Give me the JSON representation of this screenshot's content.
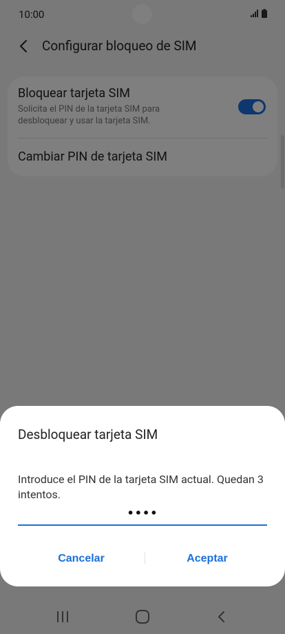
{
  "status_bar": {
    "time": "10:00",
    "icons": [
      "signal-icon",
      "battery-icon"
    ]
  },
  "app_bar": {
    "back_icon": "chevron-left-icon",
    "title": "Configurar bloqueo de SIM"
  },
  "settings": {
    "lock_sim": {
      "title": "Bloquear tarjeta SIM",
      "summary": "Solicita el PIN de la tarjeta SIM para desbloquear y usar la tarjeta SIM.",
      "enabled": true
    },
    "change_pin": {
      "title": "Cambiar PIN de tarjeta SIM"
    }
  },
  "dialog": {
    "title": "Desbloquear tarjeta SIM",
    "message": "Introduce el PIN de la tarjeta SIM actual. Quedan 3 intentos.",
    "pin_value": "••••",
    "cancel_label": "Cancelar",
    "accept_label": "Aceptar"
  },
  "nav_bar": {
    "icons": [
      "recents-icon",
      "home-icon",
      "back-icon"
    ]
  },
  "colors": {
    "accent": "#1a6fdc",
    "scrim": "rgba(0,0,0,0.5)",
    "dialog_background": "#ffffff"
  }
}
